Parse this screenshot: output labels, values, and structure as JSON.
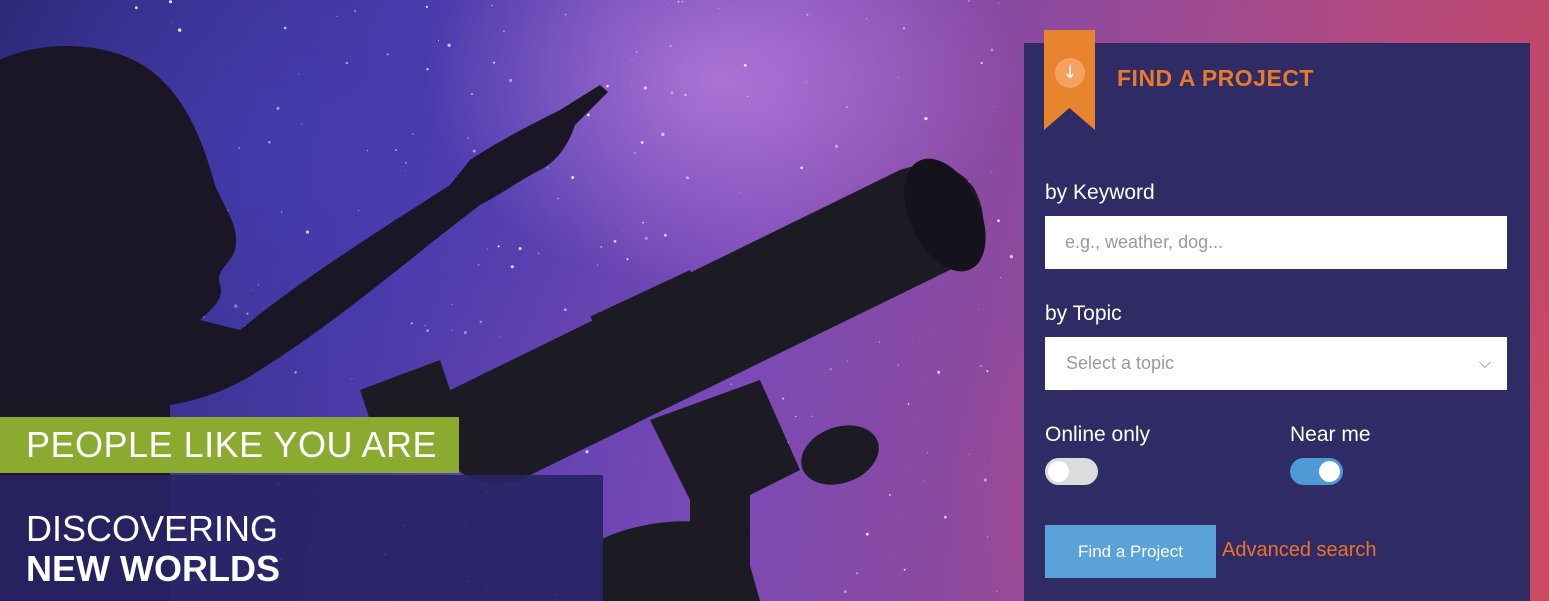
{
  "hero": {
    "tagline_top": "PEOPLE LIKE YOU ARE",
    "tagline_line1": "DISCOVERING",
    "tagline_line2": "NEW WORLDS"
  },
  "finder": {
    "title": "FIND A PROJECT",
    "ribbon_icon": "arrow-down-icon",
    "keyword": {
      "label": "by Keyword",
      "placeholder": "e.g., weather, dog..."
    },
    "topic": {
      "label": "by Topic",
      "selected": "Select a topic"
    },
    "online_only": {
      "label": "Online only",
      "enabled": false
    },
    "near_me": {
      "label": "Near me",
      "enabled": true
    },
    "submit_label": "Find a Project",
    "advanced_label": "Advanced search"
  },
  "colors": {
    "accent_orange": "#e87a2e",
    "panel_navy": "#2f2b64",
    "tag_green": "#8aab2f",
    "button_blue": "#5aa2d8",
    "toggle_on": "#4e9ad6"
  }
}
